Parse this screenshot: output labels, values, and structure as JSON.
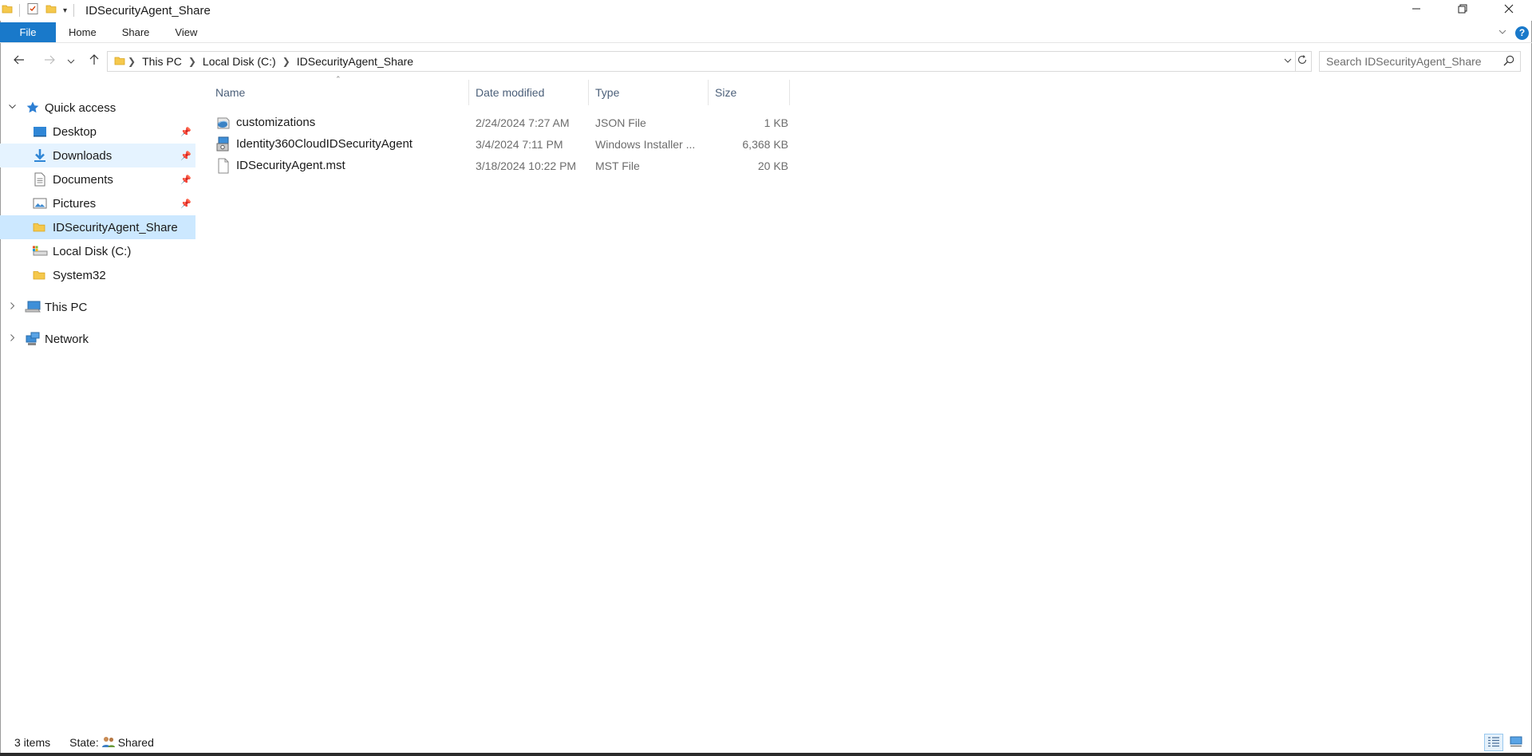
{
  "window": {
    "title": "IDSecurityAgent_Share",
    "minimize_icon": "minimize-icon",
    "restore_icon": "restore-icon",
    "close_icon": "close-icon"
  },
  "ribbon": {
    "tabs": [
      "File",
      "Home",
      "Share",
      "View"
    ],
    "accent_color": "#1979ca",
    "help_label": "?"
  },
  "address": {
    "breadcrumbs": [
      "This PC",
      "Local Disk (C:)",
      "IDSecurityAgent_Share"
    ],
    "search_placeholder": "Search IDSecurityAgent_Share"
  },
  "nav": {
    "quick_access": "Quick access",
    "items": [
      {
        "label": "Desktop",
        "icon": "desktop-icon",
        "pinned": true
      },
      {
        "label": "Downloads",
        "icon": "downloads-icon",
        "pinned": true
      },
      {
        "label": "Documents",
        "icon": "documents-icon",
        "pinned": true
      },
      {
        "label": "Pictures",
        "icon": "pictures-icon",
        "pinned": true
      },
      {
        "label": "IDSecurityAgent_Share",
        "icon": "folder-icon",
        "pinned": false
      },
      {
        "label": "Local Disk (C:)",
        "icon": "drive-icon",
        "pinned": false
      },
      {
        "label": "System32",
        "icon": "folder-icon",
        "pinned": false
      }
    ],
    "this_pc": "This PC",
    "network": "Network"
  },
  "columns": {
    "name": "Name",
    "date": "Date modified",
    "type": "Type",
    "size": "Size"
  },
  "files": [
    {
      "name": "customizations",
      "date": "2/24/2024 7:27 AM",
      "type": "JSON File",
      "size": "1 KB",
      "icon": "json-file-icon"
    },
    {
      "name": "Identity360CloudIDSecurityAgent",
      "date": "3/4/2024 7:11 PM",
      "type": "Windows Installer ...",
      "size": "6,368 KB",
      "icon": "installer-icon"
    },
    {
      "name": "IDSecurityAgent.mst",
      "date": "3/18/2024 10:22 PM",
      "type": "MST File",
      "size": "20 KB",
      "icon": "blank-file-icon"
    }
  ],
  "status": {
    "item_count": "3 items",
    "state_label": "State:",
    "state_value": "Shared"
  }
}
